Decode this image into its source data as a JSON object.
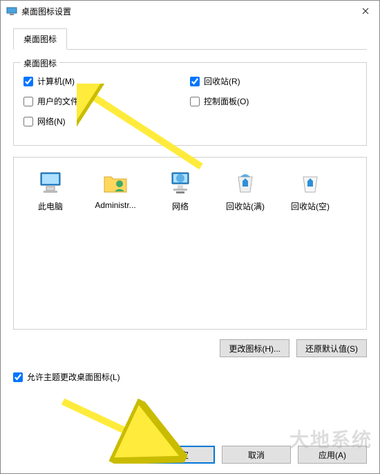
{
  "window": {
    "title": "桌面图标设置"
  },
  "tab": {
    "label": "桌面图标"
  },
  "group": {
    "legend": "桌面图标",
    "checks": {
      "computer": "计算机(M)",
      "recycle": "回收站(R)",
      "userfiles": "用户的文件(U)",
      "control": "控制面板(O)",
      "network": "网络(N)"
    }
  },
  "icons": {
    "thispc": "此电脑",
    "admin": "Administr...",
    "network": "网络",
    "recycle_full": "回收站(满)",
    "recycle_empty": "回收站(空)"
  },
  "buttons": {
    "change_icon": "更改图标(H)...",
    "restore_default": "还原默认值(S)",
    "ok": "确定",
    "cancel": "取消",
    "apply": "应用(A)"
  },
  "allow_themes": "允许主题更改桌面图标(L)",
  "watermark": "大地系统"
}
